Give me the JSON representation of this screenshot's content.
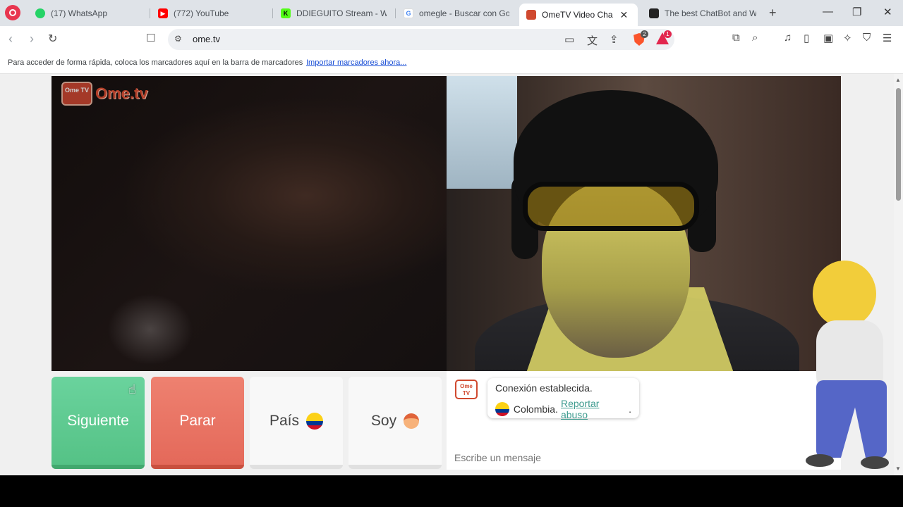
{
  "tabs": [
    {
      "label": "(17) WhatsApp",
      "icon": "whatsapp-icon",
      "color": "#25d366"
    },
    {
      "label": "(772) YouTube",
      "icon": "youtube-icon",
      "color": "#ff0000"
    },
    {
      "label": "DDIEGUITO Stream - Wat",
      "icon": "kick-icon",
      "color": "#53fc18"
    },
    {
      "label": "omegle - Buscar con Goo",
      "icon": "google-icon",
      "color": "#4285f4"
    },
    {
      "label": "OmeTV Video Cha",
      "icon": "ometv-icon",
      "color": "#d0492f"
    },
    {
      "label": "The best ChatBot and Wi",
      "icon": "chatbot-icon",
      "color": "#222222"
    }
  ],
  "toolbar": {
    "url": "ome.tv",
    "brave_count": "2",
    "alert_count": "1"
  },
  "bookmarks": {
    "hint": "Para acceder de forma rápida, coloca los marcadores aquí en la barra de marcadores",
    "import_link": "Importar marcadores ahora..."
  },
  "logo": {
    "badge": "Ome TV",
    "name": "Ome.tv"
  },
  "controls": {
    "next": "Siguiente",
    "stop": "Parar",
    "country": "País",
    "gender": "Soy"
  },
  "chat": {
    "logo": "Ome TV",
    "status": "Conexión establecida.",
    "country": "Colombia.",
    "report": "Reportar abuso",
    "report_suffix": ".",
    "placeholder": "Escribe un mensaje"
  }
}
